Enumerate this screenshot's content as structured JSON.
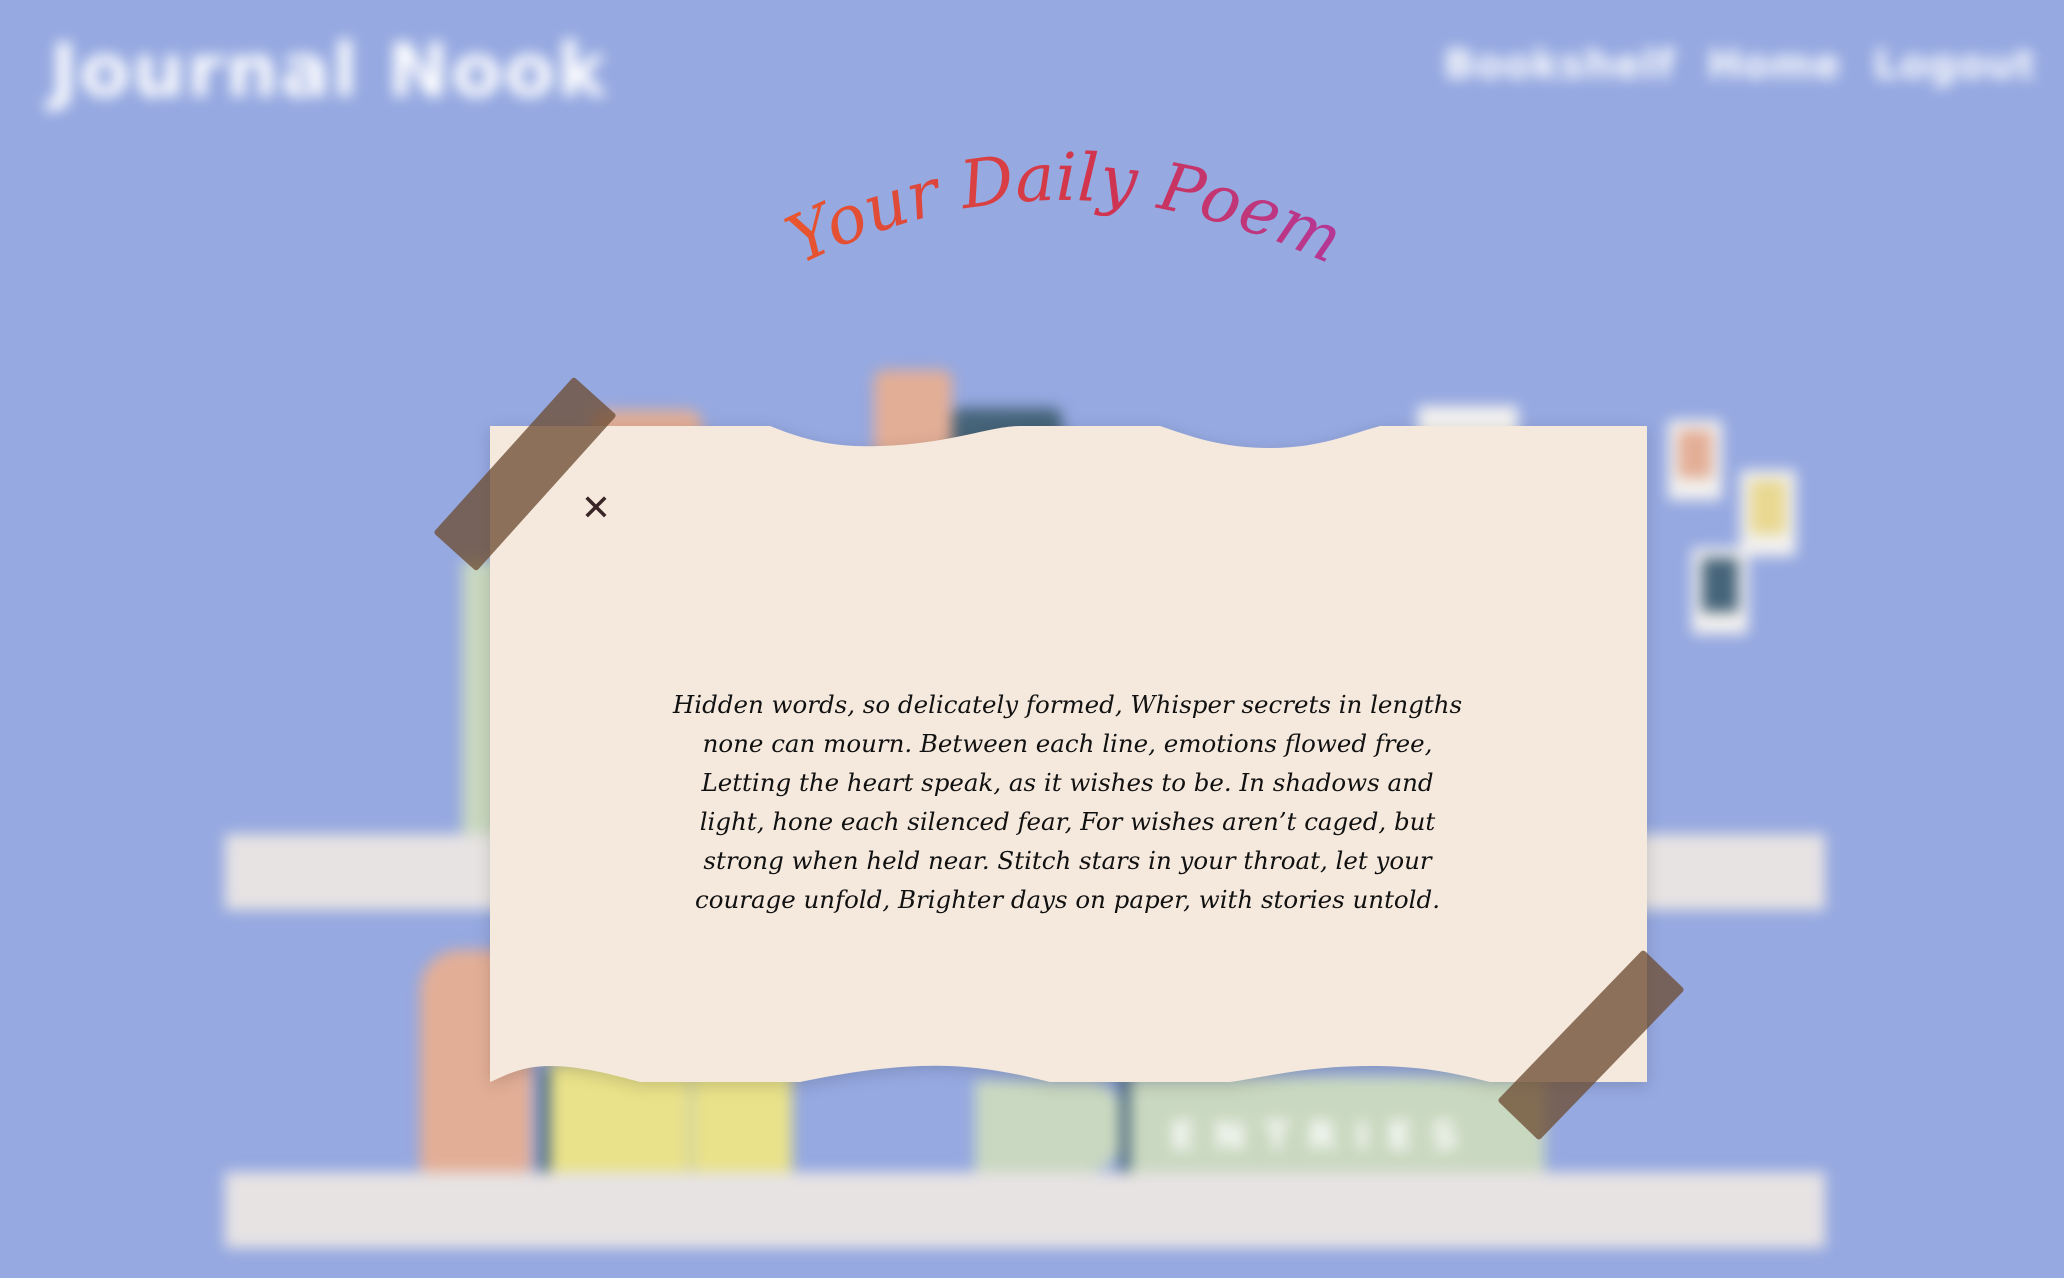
{
  "header": {
    "brand": "Journal Nook",
    "nav": [
      {
        "label": "Bookshelf"
      },
      {
        "label": "Home"
      },
      {
        "label": "Logout"
      }
    ]
  },
  "background": {
    "book_label": "ENTRIES"
  },
  "page_title": "Your Daily Poem",
  "poem_card": {
    "close_icon": "close-icon",
    "text": "Hidden words, so delicately formed, Whisper secrets in lengths none can mourn. Between each line, emotions flowed free, Letting the heart speak, as it wishes to be. In shadows and light, hone each silenced fear, For wishes aren’t caged, but strong when held near. Stitch stars in your throat, let your courage unfold, Brighter days on paper, with stories untold."
  },
  "colors": {
    "background": "#96a9e1",
    "paper": "#f5e9de",
    "tape": "#6e4e34",
    "title_gradient": [
      "#e9572c",
      "#d1344c",
      "#b3379a"
    ]
  }
}
